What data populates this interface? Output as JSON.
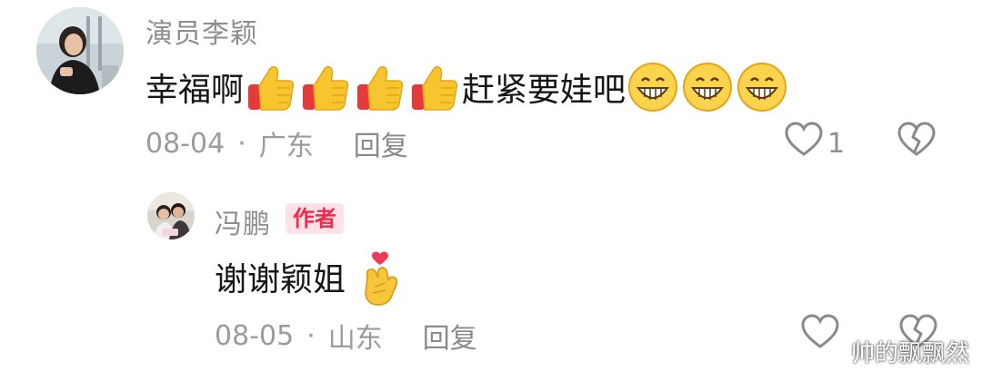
{
  "comment": {
    "username": "演员李颖",
    "text_before": "幸福啊",
    "text_middle": "赶紧要娃吧",
    "thumbs_emoji": "thumbs-up-emoji",
    "grin_emoji": "grinning-emoji",
    "date": "08-04",
    "separator": "·",
    "location": "广东",
    "reply_label": "回复",
    "like_count": "1",
    "like_icon": "heart-outline-icon",
    "dislike_icon": "broken-heart-icon"
  },
  "reply": {
    "username": "冯鹏",
    "badge": "作者",
    "text": "谢谢颖姐",
    "emoji": "finger-heart-emoji",
    "date": "08-05",
    "separator": "·",
    "location": "山东",
    "reply_label": "回复",
    "like_icon": "heart-outline-icon",
    "dislike_icon": "broken-heart-icon"
  },
  "watermark": "帅的飘飘然",
  "colors": {
    "badge_text": "#f0294f",
    "badge_bg": "#fde3e7",
    "meta_text": "#9b9b9b"
  }
}
